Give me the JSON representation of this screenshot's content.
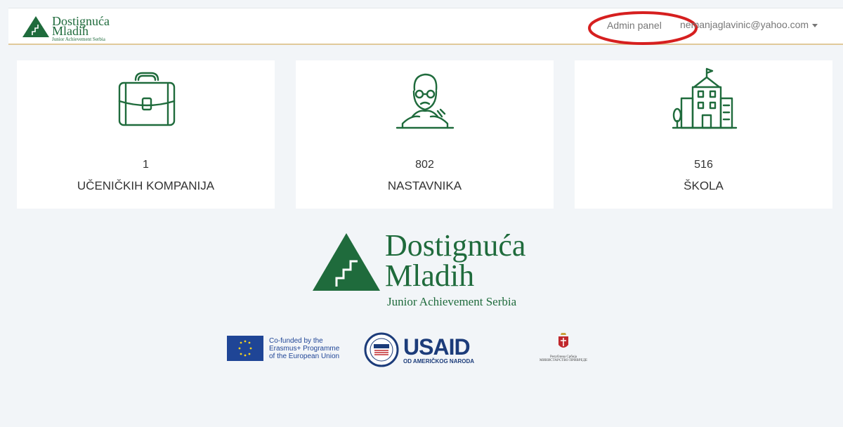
{
  "header": {
    "brand": {
      "line1": "Dostignuća",
      "line2": "Mladih",
      "line3": "Junior Achievement Serbia"
    },
    "admin_label": "Admin panel",
    "user_email": "nemanjaglavinic@yahoo.com"
  },
  "stats": [
    {
      "icon": "briefcase-icon",
      "value": "1",
      "label": "UČENIČKIH KOMPANIJA"
    },
    {
      "icon": "teacher-icon",
      "value": "802",
      "label": "NASTAVNIKA"
    },
    {
      "icon": "school-icon",
      "value": "516",
      "label": "ŠKOLA"
    }
  ],
  "footer_logo": {
    "line1": "Dostignuća",
    "line2": "Mladih",
    "line3": "Junior Achievement Serbia"
  },
  "partners": {
    "eu": "Co-funded by the Erasmus+ Programme of the European Union",
    "eu_lines": [
      "Co-funded by the",
      "Erasmus+ Programme",
      "of the European Union"
    ],
    "usaid_name": "USAID",
    "usaid_sub": "OD AMERIČKOG NARODA",
    "serbia_line1": "Република Србија",
    "serbia_line2": "МИНИСТАРСТВО ПРИВРЕДЕ"
  },
  "colors": {
    "brand_green": "#1f6b3c",
    "page_bg": "#f2f5f8",
    "annotation_red": "#d61f1f"
  }
}
